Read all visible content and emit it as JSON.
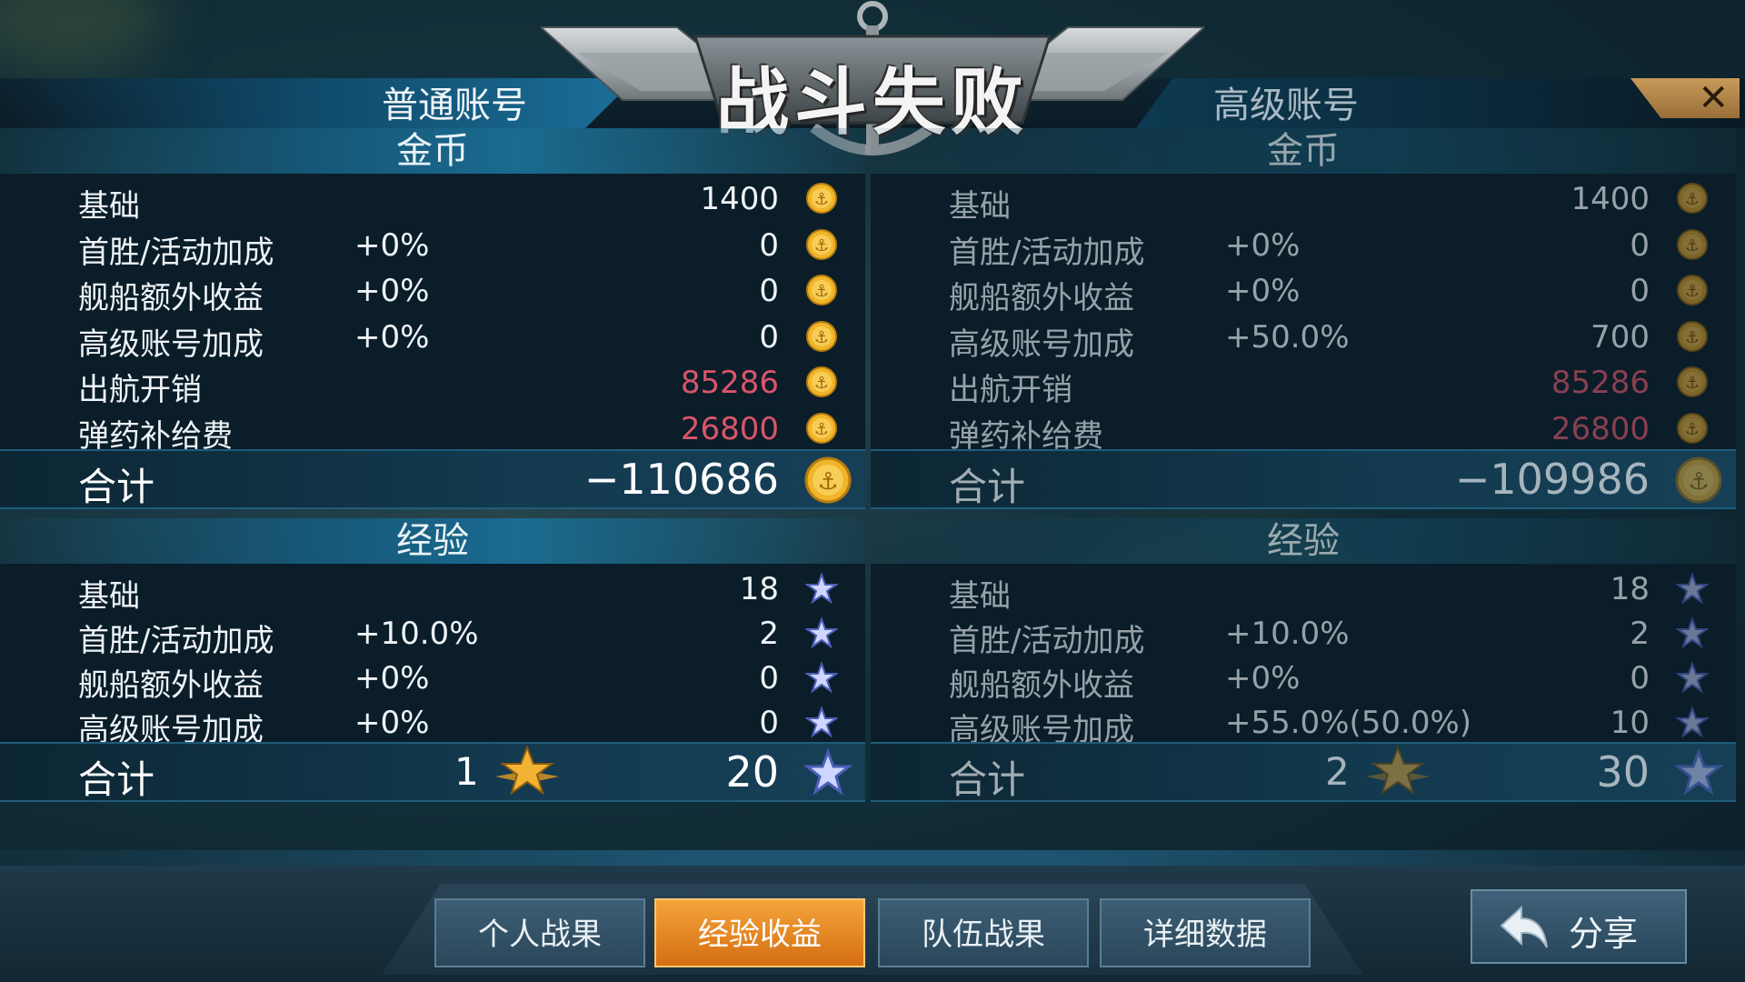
{
  "header": {
    "title": "战斗失败",
    "tab_normal": "普通账号",
    "tab_premium": "高级账号",
    "close": "✕"
  },
  "panels": [
    {
      "gold_title": "金币",
      "gold_rows": [
        {
          "label": "基础",
          "pct": "",
          "value": "1400",
          "negative": false
        },
        {
          "label": "首胜/活动加成",
          "pct": "+0%",
          "value": "0",
          "negative": false
        },
        {
          "label": "舰船额外收益",
          "pct": "+0%",
          "value": "0",
          "negative": false
        },
        {
          "label": "高级账号加成",
          "pct": "+0%",
          "value": "0",
          "negative": false
        },
        {
          "label": "出航开销",
          "pct": "",
          "value": "85286",
          "negative": true
        },
        {
          "label": "弹药补给费",
          "pct": "",
          "value": "26800",
          "negative": true
        }
      ],
      "gold_total_label": "合计",
      "gold_total": "−110686",
      "exp_title": "经验",
      "exp_rows": [
        {
          "label": "基础",
          "pct": "",
          "value": "18"
        },
        {
          "label": "首胜/活动加成",
          "pct": "+10.0%",
          "value": "2"
        },
        {
          "label": "舰船额外收益",
          "pct": "+0%",
          "value": "0"
        },
        {
          "label": "高级账号加成",
          "pct": "+0%",
          "value": "0"
        }
      ],
      "exp_total_label": "合计",
      "exp_star_count": "1",
      "exp_total": "20"
    },
    {
      "gold_title": "金币",
      "gold_rows": [
        {
          "label": "基础",
          "pct": "",
          "value": "1400",
          "negative": false
        },
        {
          "label": "首胜/活动加成",
          "pct": "+0%",
          "value": "0",
          "negative": false
        },
        {
          "label": "舰船额外收益",
          "pct": "+0%",
          "value": "0",
          "negative": false
        },
        {
          "label": "高级账号加成",
          "pct": "+50.0%",
          "value": "700",
          "negative": false
        },
        {
          "label": "出航开销",
          "pct": "",
          "value": "85286",
          "negative": true
        },
        {
          "label": "弹药补给费",
          "pct": "",
          "value": "26800",
          "negative": true
        }
      ],
      "gold_total_label": "合计",
      "gold_total": "−109986",
      "exp_title": "经验",
      "exp_rows": [
        {
          "label": "基础",
          "pct": "",
          "value": "18"
        },
        {
          "label": "首胜/活动加成",
          "pct": "+10.0%",
          "value": "2"
        },
        {
          "label": "舰船额外收益",
          "pct": "+0%",
          "value": "0"
        },
        {
          "label": "高级账号加成",
          "pct": "+55.0%(50.0%)",
          "value": "10"
        }
      ],
      "exp_total_label": "合计",
      "exp_star_count": "2",
      "exp_total": "30"
    }
  ],
  "tabs": [
    {
      "label": "个人战果",
      "active": false
    },
    {
      "label": "经验收益",
      "active": true
    },
    {
      "label": "队伍战果",
      "active": false
    },
    {
      "label": "详细数据",
      "active": false
    }
  ],
  "share": {
    "label": "分享"
  },
  "icons": {
    "coin": "coin-icon",
    "star": "star-icon",
    "gold_star": "gold-star-icon",
    "back_arrow": "back-arrow-icon"
  },
  "colors": {
    "negative": "#d9556a",
    "active_tab": "#e8891f",
    "accent": "#1a6b90"
  }
}
